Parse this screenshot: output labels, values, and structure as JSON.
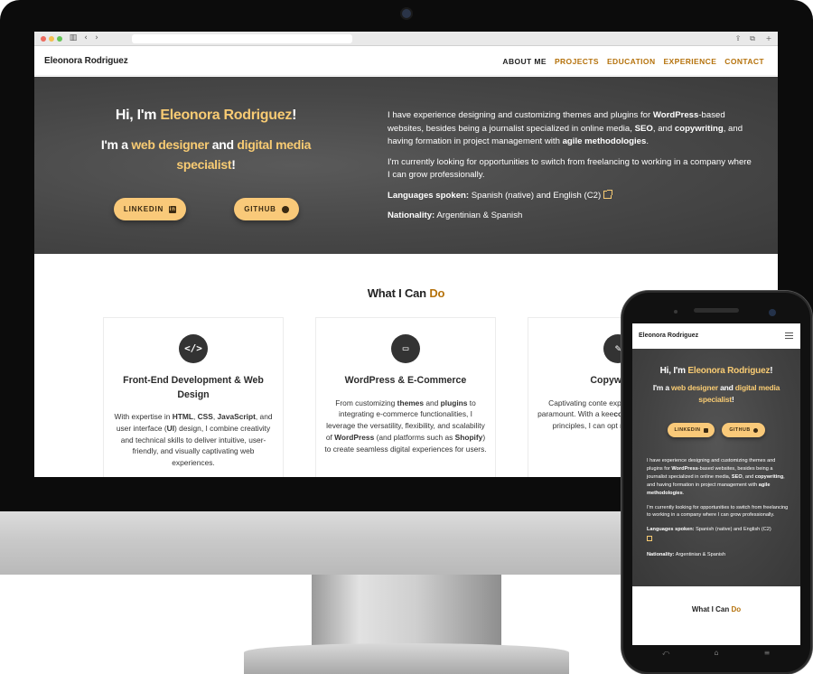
{
  "browser": {
    "back_glyph": "‹",
    "forward_glyph": "›",
    "share_glyph": "⇪",
    "tabs_glyph": "⧉",
    "add_glyph": "+"
  },
  "site": {
    "brand": "Eleonora Rodriguez",
    "menu": [
      "ABOUT ME",
      "PROJECTS",
      "EDUCATION",
      "EXPERIENCE",
      "CONTACT"
    ]
  },
  "hero": {
    "greeting_prefix": "Hi, I'm ",
    "name": "Eleonora Rodriguez",
    "greeting_suffix": "!",
    "role_prefix": "I'm a ",
    "role_1": "web designer",
    "role_mid": " and ",
    "role_2": "digital media specialist",
    "role_suffix": "!",
    "linkedin_label": "LINKEDIN",
    "github_label": "GITHUB",
    "bio_1": "I have experience designing and customizing themes and plugins for ",
    "bio_wp": "WordPress",
    "bio_2": "-based websites, besides being a journalist specialized in online media, ",
    "bio_seo": "SEO",
    "bio_3": ", and ",
    "bio_copy": "copywriting",
    "bio_4": ", and having formation in project management with ",
    "bio_agile": "agile methodologies",
    "bio_5": ".",
    "looking": "I'm currently looking for opportunities to switch from freelancing to working in a company where I can grow professionally.",
    "languages_label": "Languages spoken:",
    "languages_value": " Spanish (native) and English (C2)",
    "nationality_label": "Nationality:",
    "nationality_value": " Argentinian & Spanish"
  },
  "services": {
    "title_1": "What I Can ",
    "title_2": "Do",
    "cards": [
      {
        "icon": "</>",
        "title": "Front-End Development & Web Design",
        "b1": "With expertise in ",
        "b2": "HTML",
        "b3": ", ",
        "b4": "CSS",
        "b5": ", ",
        "b6": "JavaScript",
        "b7": ", and user interface (",
        "b8": "UI",
        "b9": ") design, I combine creativity and technical skills to deliver intuitive, user-friendly, and visually captivating web experiences."
      },
      {
        "icon": "▭",
        "title": "WordPress & E-Commerce",
        "b1": "From customizing ",
        "b2": "themes",
        "b3": " and ",
        "b4": "plugins",
        "b5": " to integrating e-commerce functionalities, I leverage the versatility, flexibility, and scalability of ",
        "b6": "WordPress",
        "b7": " (and platforms such as ",
        "b8": "Shopify",
        "b9": ") to create seamless digital experiences for users."
      },
      {
        "icon": "✎",
        "title": "Copywriting",
        "b1": "Captivating conte",
        "b2": "",
        "b3": " experiences, and searc",
        "b4": "",
        "b5": " paramount. With a kee",
        "b6": "copywriting",
        "b7": ", and a deep principles, I can opt maximum impact a",
        "b8": "",
        "b9": ""
      }
    ]
  },
  "phone": {
    "languages_value": " Spanish (native) and English (C2)",
    "back_glyph": "⤺",
    "home_glyph": "⌂",
    "menu_glyph": "≡"
  }
}
